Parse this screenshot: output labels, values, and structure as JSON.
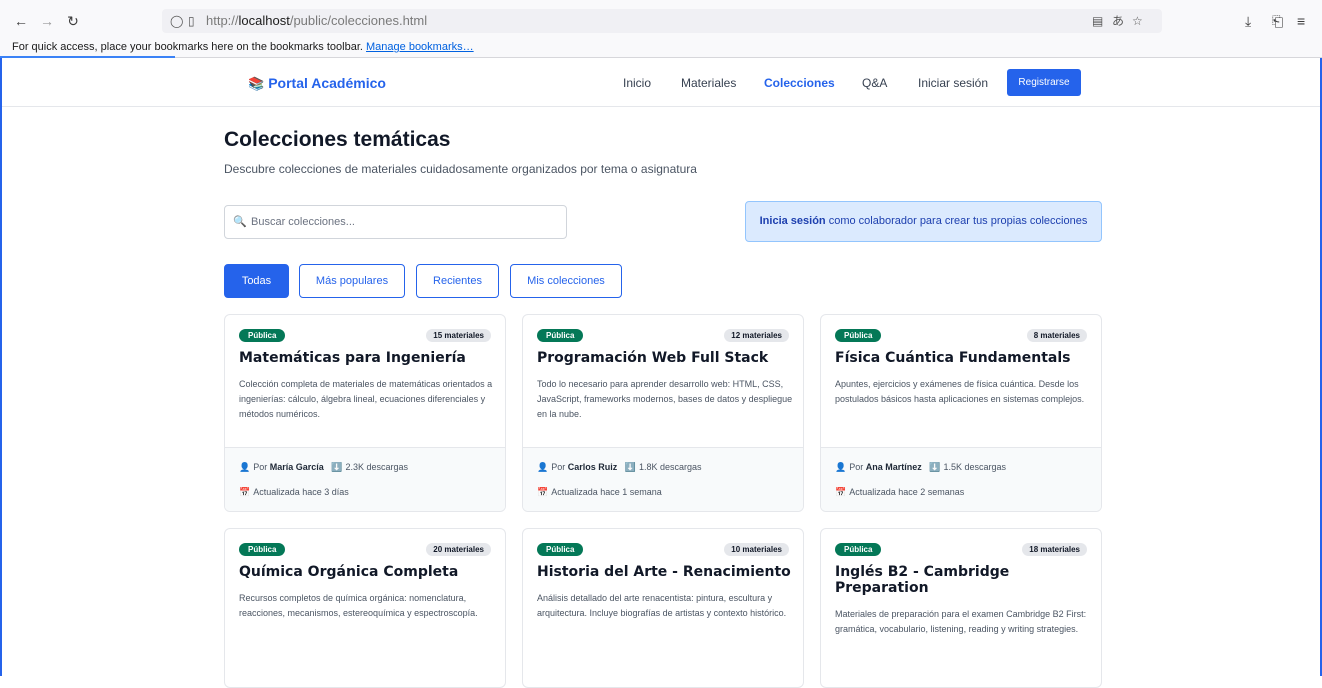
{
  "browser": {
    "url_prefix": "http://",
    "url_host": "localhost",
    "url_path": "/public/colecciones.html",
    "bookmarks_text": "For quick access, place your bookmarks here on the bookmarks toolbar.",
    "bookmarks_link": "Manage bookmarks…"
  },
  "header": {
    "logo": "Portal Académico",
    "nav": [
      "Inicio",
      "Materiales",
      "Colecciones",
      "Q&A",
      "Iniciar sesión"
    ],
    "register": "Registrarse"
  },
  "page": {
    "title": "Colecciones temáticas",
    "subtitle": "Descubre colecciones de materiales cuidadosamente organizados por tema o asignatura",
    "search_placeholder": "Buscar colecciones...",
    "banner_strong": "Inicia sesión",
    "banner_text": " como colaborador para crear tus propias colecciones",
    "filters": [
      "Todas",
      "Más populares",
      "Recientes",
      "Mis colecciones"
    ]
  },
  "cards": [
    {
      "badge": "Pública",
      "count": "15 materiales",
      "title": "Matemáticas para Ingeniería",
      "desc": "Colección completa de materiales de matemáticas orientados a ingenierías: cálculo, álgebra lineal, ecuaciones diferenciales y métodos numéricos.",
      "by": "Por",
      "author": "María García",
      "downloads": "2.3K descargas",
      "updated": "Actualizada hace 3 días"
    },
    {
      "badge": "Pública",
      "count": "12 materiales",
      "title": "Programación Web Full Stack",
      "desc": "Todo lo necesario para aprender desarrollo web: HTML, CSS, JavaScript, frameworks modernos, bases de datos y despliegue en la nube.",
      "by": "Por",
      "author": "Carlos Ruiz",
      "downloads": "1.8K descargas",
      "updated": "Actualizada hace 1 semana"
    },
    {
      "badge": "Pública",
      "count": "8 materiales",
      "title": "Física Cuántica Fundamentals",
      "desc": "Apuntes, ejercicios y exámenes de física cuántica. Desde los postulados básicos hasta aplicaciones en sistemas complejos.",
      "by": "Por",
      "author": "Ana Martínez",
      "downloads": "1.5K descargas",
      "updated": "Actualizada hace 2 semanas"
    },
    {
      "badge": "Pública",
      "count": "20 materiales",
      "title": "Química Orgánica Completa",
      "desc": "Recursos completos de química orgánica: nomenclatura, reacciones, mecanismos, estereoquímica y espectroscopía."
    },
    {
      "badge": "Pública",
      "count": "10 materiales",
      "title": "Historia del Arte - Renacimiento",
      "desc": "Análisis detallado del arte renacentista: pintura, escultura y arquitectura. Incluye biografías de artistas y contexto histórico."
    },
    {
      "badge": "Pública",
      "count": "18 materiales",
      "title": "Inglés B2 - Cambridge Preparation",
      "desc": "Materiales de preparación para el examen Cambridge B2 First: gramática, vocabulario, listening, reading y writing strategies."
    }
  ]
}
